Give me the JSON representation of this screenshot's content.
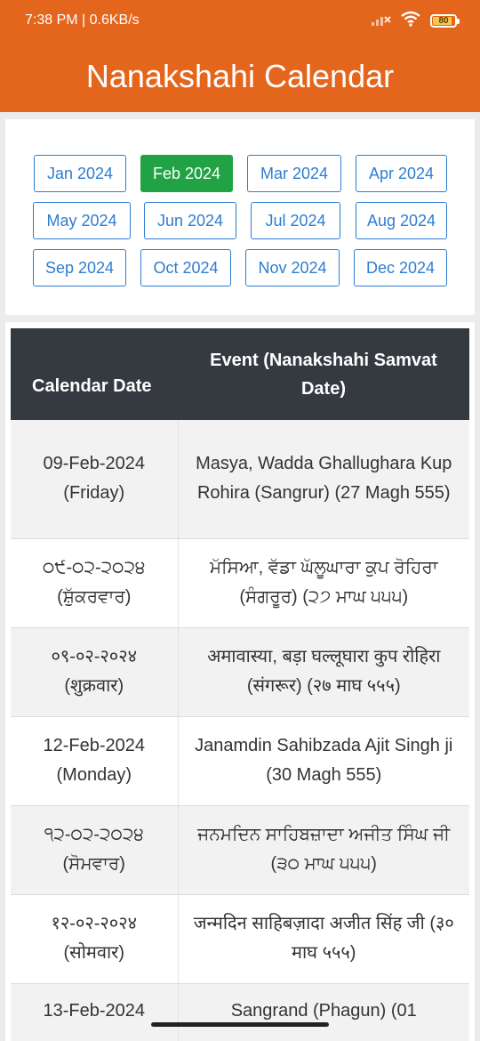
{
  "status_bar": {
    "time_speed": "7:38 PM | 0.6KB/s",
    "battery_level": "80",
    "icons": [
      "signal-icon",
      "wifi-icon",
      "battery-icon"
    ]
  },
  "app_bar": {
    "title": "Nanakshahi Calendar"
  },
  "months": {
    "selected": "Feb 2024",
    "items": [
      "Jan 2024",
      "Feb 2024",
      "Mar 2024",
      "Apr 2024",
      "May 2024",
      "Jun 2024",
      "Jul 2024",
      "Aug 2024",
      "Sep 2024",
      "Oct 2024",
      "Nov 2024",
      "Dec 2024"
    ]
  },
  "table": {
    "headers": {
      "date": "Calendar Date",
      "event": "Event (Nanakshahi Samvat Date)"
    },
    "rows": [
      {
        "date": "09-Feb-2024 (Friday)",
        "event": "Masya, Wadda Ghallughara Kup Rohira (Sangrur) (27 Magh 555)"
      },
      {
        "date": "੦੯-੦੨-੨੦੨੪ (ਸ਼ੁੱਕਰਵਾਰ)",
        "event": "ਮੱਸਿਆ, ਵੱਡਾ ਘੱਲੂਘਾਰਾ ਕੁਪ ਰੋਹਿਰਾ (ਸੰਗਰੂਰ) (੨੭ ਮਾਘ ੫੫੫)"
      },
      {
        "date": "०९-०२-२०२४ (शुक्रवार)",
        "event": "अमावास्या, बड़ा घल्लूघारा कुप रोहिरा (संगरूर) (२७ माघ ५५५)"
      },
      {
        "date": "12-Feb-2024 (Monday)",
        "event": "Janamdin Sahibzada Ajit Singh ji (30 Magh 555)"
      },
      {
        "date": "੧੨-੦੨-੨੦੨੪ (ਸੋਮਵਾਰ)",
        "event": "ਜਨਮਦਿਨ ਸਾਹਿਬਜ਼ਾਦਾ ਅਜੀਤ ਸਿੰਘ ਜੀ (੩੦ ਮਾਘ ੫੫੫)"
      },
      {
        "date": "१२-०२-२०२४ (सोमवार)",
        "event": "जन्मदिन साहिबज़ादा अजीत सिंह जी (३० माघ ५५५)"
      },
      {
        "date": "13-Feb-2024",
        "event": "Sangrand (Phagun) (01"
      }
    ]
  }
}
